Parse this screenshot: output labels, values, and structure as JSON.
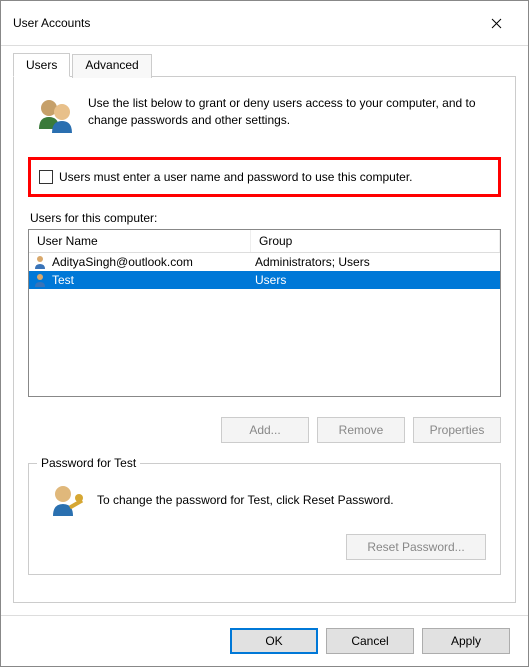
{
  "window": {
    "title": "User Accounts"
  },
  "tabs": {
    "users": "Users",
    "advanced": "Advanced"
  },
  "intro": "Use the list below to grant or deny users access to your computer, and to change passwords and other settings.",
  "checkbox_label": "Users must enter a user name and password to use this computer.",
  "users_label": "Users for this computer:",
  "columns": {
    "name": "User Name",
    "group": "Group"
  },
  "rows": [
    {
      "name": "AdityaSingh@outlook.com",
      "group": "Administrators; Users",
      "selected": false
    },
    {
      "name": "Test",
      "group": "Users",
      "selected": true
    }
  ],
  "buttons": {
    "add": "Add...",
    "remove": "Remove",
    "properties": "Properties"
  },
  "pw_section": {
    "legend": "Password for Test",
    "text": "To change the password for Test, click Reset Password.",
    "reset": "Reset Password..."
  },
  "footer": {
    "ok": "OK",
    "cancel": "Cancel",
    "apply": "Apply"
  }
}
